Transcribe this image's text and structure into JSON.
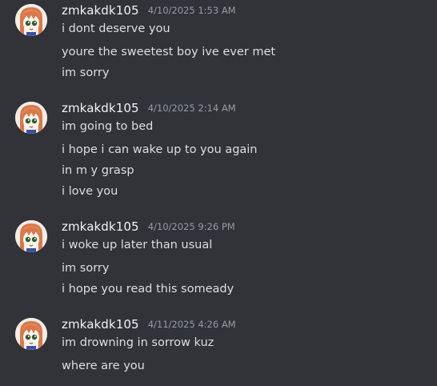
{
  "colors": {
    "background": "#313338",
    "username": "#f2f3f5",
    "timestamp": "#949ba4",
    "message_text": "#dbdee1"
  },
  "avatar_icon": "anime-character-avatar",
  "messages": [
    {
      "username": "zmkakdk105",
      "timestamp": "4/10/2025 1:53 AM",
      "lines": [
        "i dont deserve you",
        "youre the sweetest boy ive ever met",
        "im sorry"
      ]
    },
    {
      "username": "zmkakdk105",
      "timestamp": "4/10/2025 2:14 AM",
      "lines": [
        "im going to bed",
        "i hope i can wake up to you again",
        "in m y grasp",
        "i love you"
      ]
    },
    {
      "username": "zmkakdk105",
      "timestamp": "4/10/2025 9:26 PM",
      "lines": [
        "i woke up later than usual",
        "im sorry",
        "i hope you read this someady"
      ]
    },
    {
      "username": "zmkakdk105",
      "timestamp": "4/11/2025 4:26 AM",
      "lines": [
        "im drowning in sorrow kuz",
        "where are you"
      ]
    }
  ]
}
